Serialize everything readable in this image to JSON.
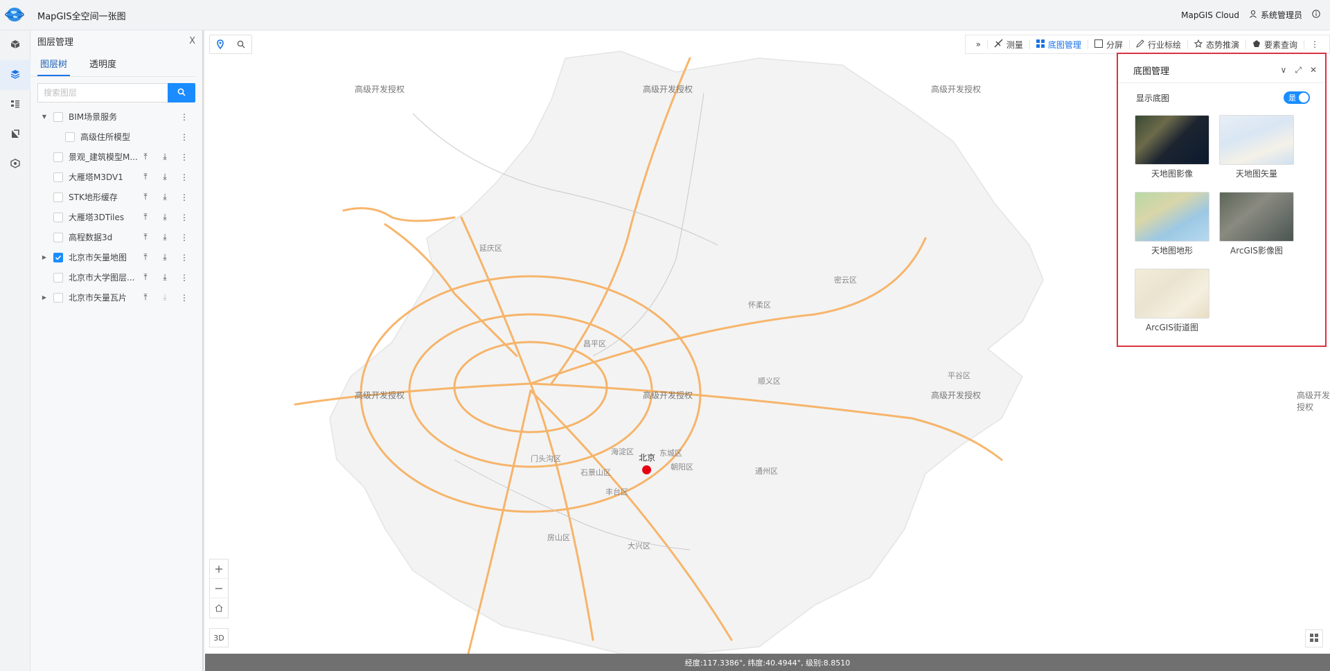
{
  "app": {
    "title": "MapGIS全空间一张图"
  },
  "header": {
    "cloud_label": "MapGIS Cloud",
    "user_label": "系统管理员"
  },
  "layer_panel": {
    "title": "图层管理",
    "close": "X",
    "tabs": [
      {
        "label": "图层树"
      },
      {
        "label": "透明度"
      }
    ],
    "search_placeholder": "搜索图层",
    "items": [
      {
        "label": "BIM场景服务",
        "checked": false
      },
      {
        "label": "高级住所模型",
        "checked": false
      },
      {
        "label": "景观_建筑模型M...",
        "checked": false
      },
      {
        "label": "大雁塔M3DV1",
        "checked": false
      },
      {
        "label": "STK地形缓存",
        "checked": false
      },
      {
        "label": "大雁塔3DTiles",
        "checked": false
      },
      {
        "label": "高程数据3d",
        "checked": false
      },
      {
        "label": "北京市矢量地图",
        "checked": true
      },
      {
        "label": "北京市大学图层...",
        "checked": false
      },
      {
        "label": "北京市矢量瓦片",
        "checked": false
      }
    ]
  },
  "toolbar": {
    "expand": "»",
    "items": [
      {
        "label": "测量"
      },
      {
        "label": "底图管理"
      },
      {
        "label": "分屏"
      },
      {
        "label": "行业标绘"
      },
      {
        "label": "态势推演"
      },
      {
        "label": "要素查询"
      }
    ]
  },
  "basemap_panel": {
    "title": "底图管理",
    "show_label": "显示底图",
    "toggle_label": "是",
    "maps": [
      {
        "label": "天地图影像"
      },
      {
        "label": "天地图矢量"
      },
      {
        "label": "天地图地形"
      },
      {
        "label": "ArcGIS影像图"
      },
      {
        "label": "ArcGIS街道图"
      }
    ]
  },
  "map": {
    "watermark": "高级开发授权",
    "city_label": "北京",
    "districts": [
      "延庆区",
      "怀柔区",
      "密云区",
      "昌平区",
      "顺义区",
      "平谷区",
      "门头沟区",
      "海淀区",
      "东城区",
      "朝阳区",
      "石景山区",
      "丰台区",
      "通州区",
      "房山区",
      "大兴区"
    ],
    "btn_3d": "3D"
  },
  "status": {
    "text": "经度:117.3386°, 纬度:40.4944°, 级别:8.8510"
  },
  "colors": {
    "accent": "#1a8cff",
    "road": "#f7ae5c",
    "highlight_border": "#d9333f"
  }
}
